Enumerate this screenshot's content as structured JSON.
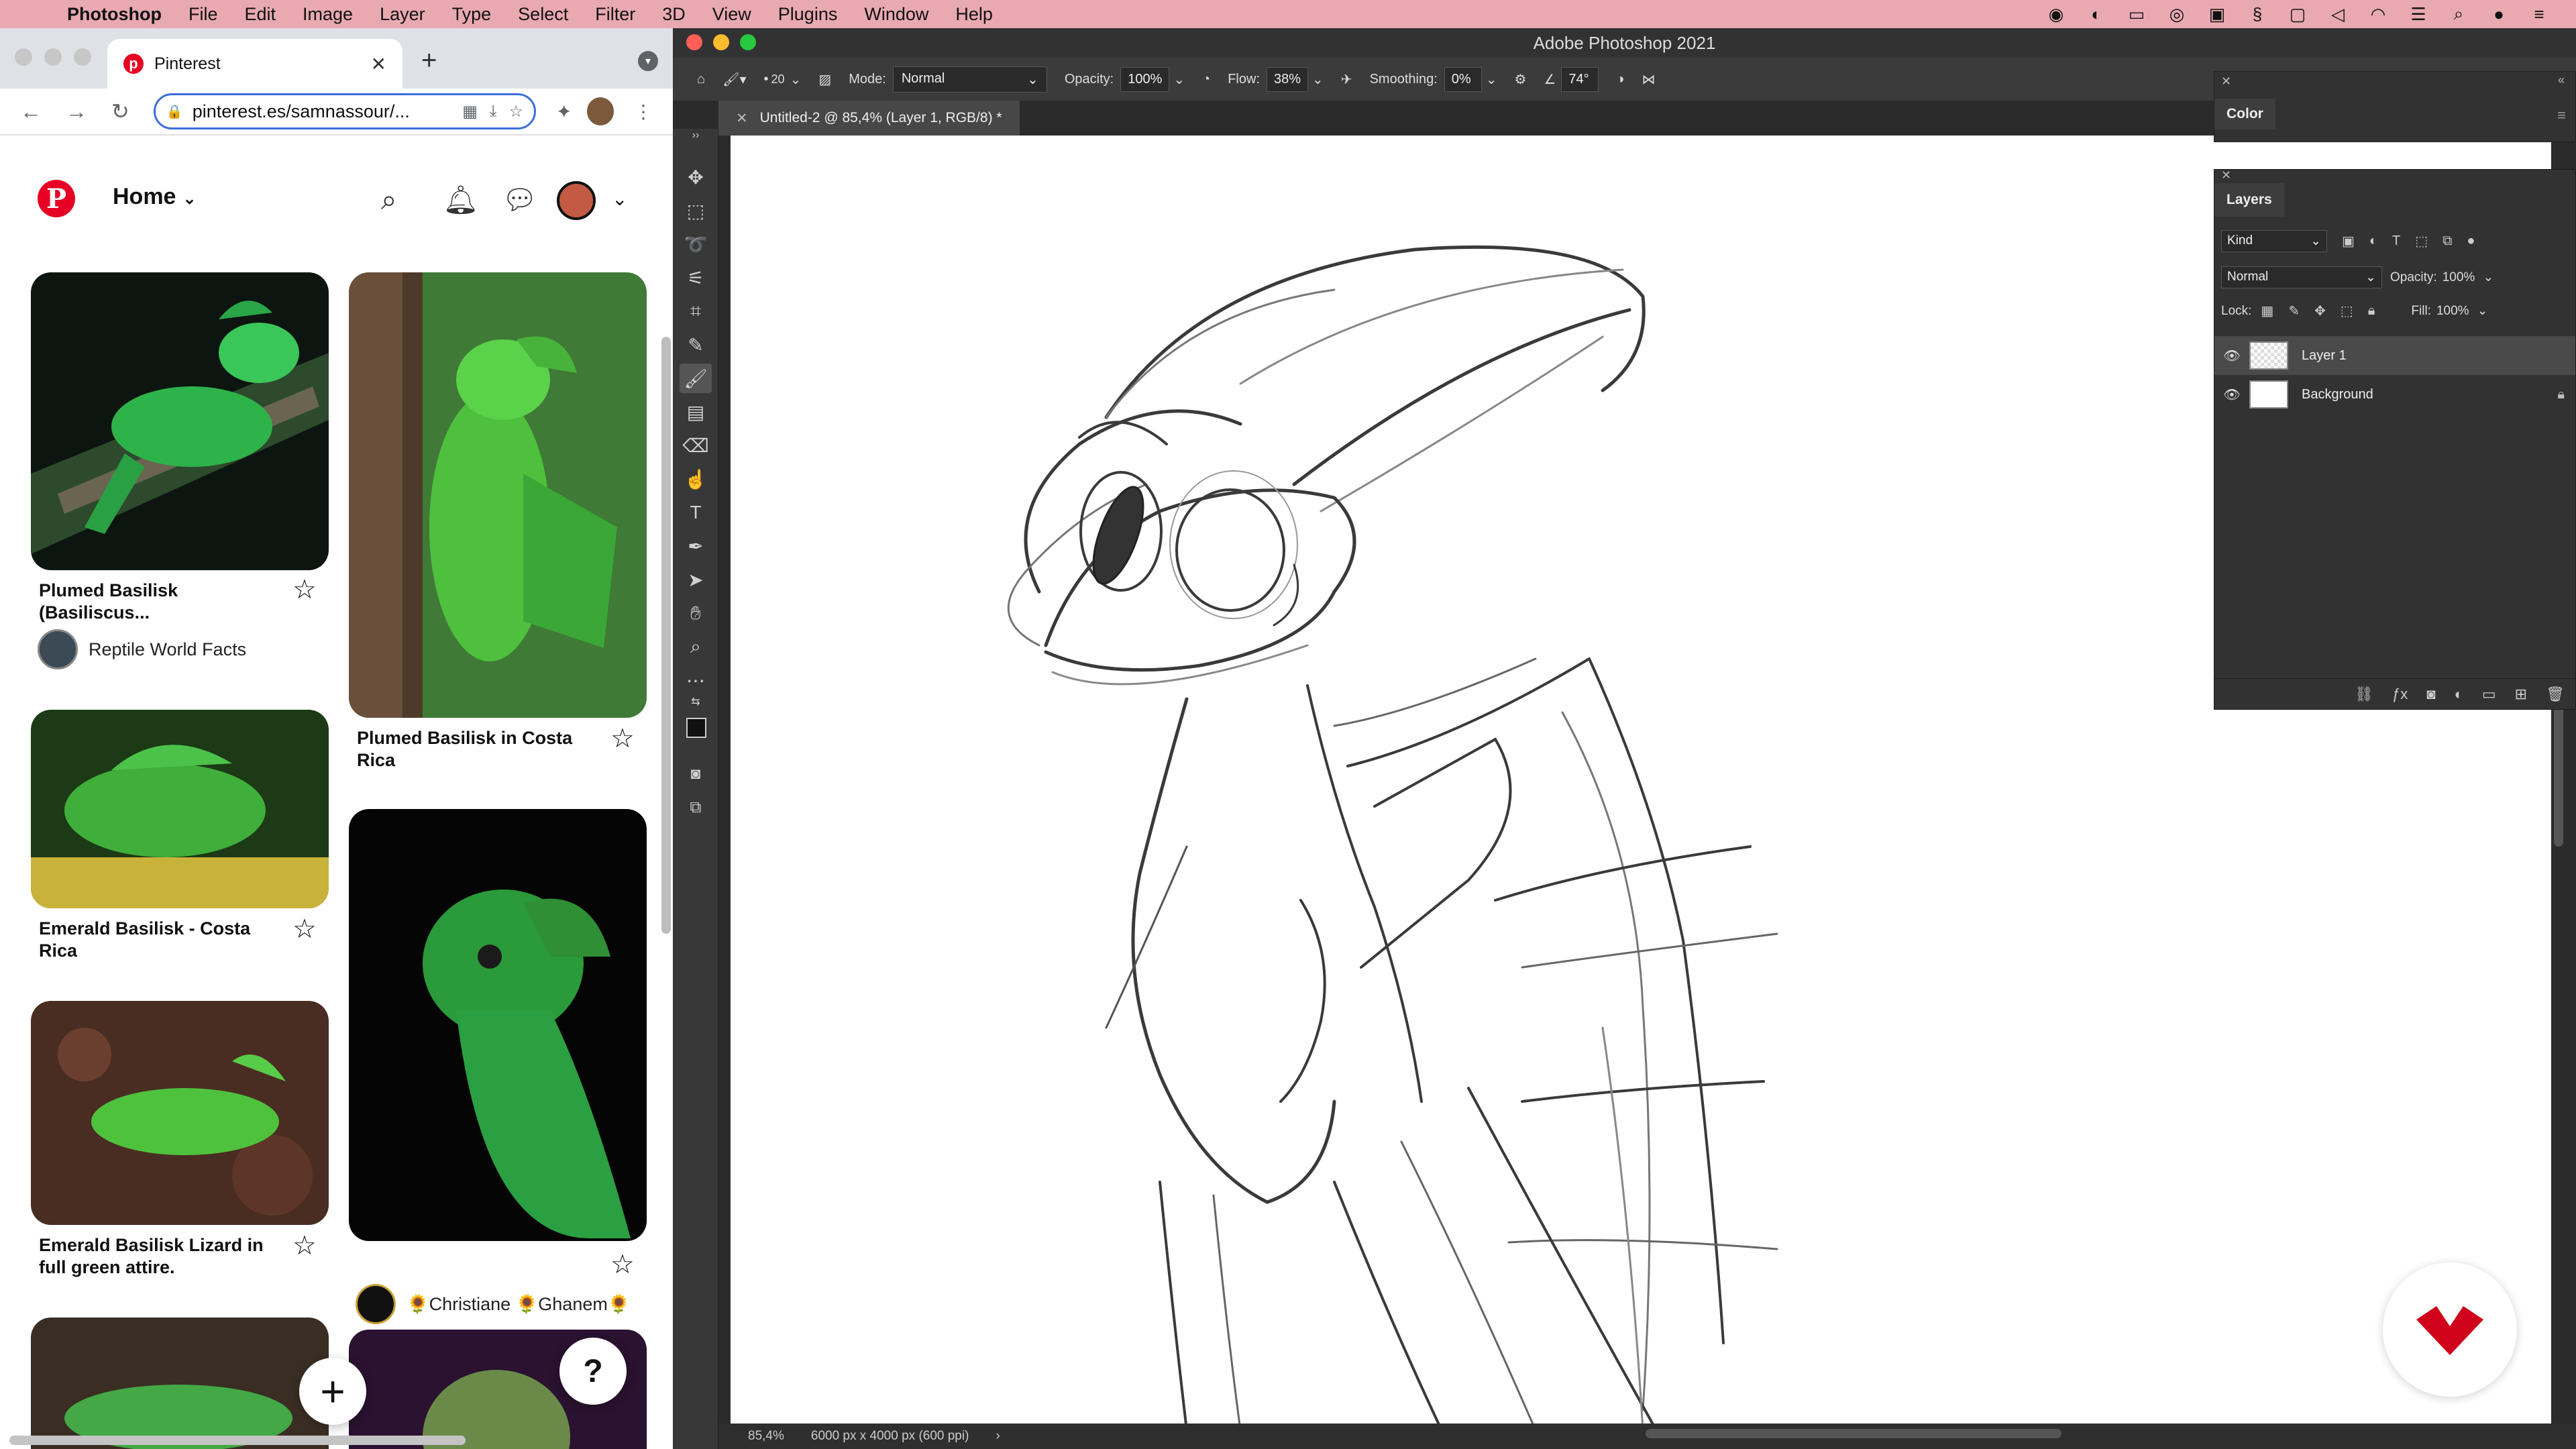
{
  "menubar": {
    "app": "Photoshop",
    "items": [
      "File",
      "Edit",
      "Image",
      "Layer",
      "Type",
      "Select",
      "Filter",
      "3D",
      "View",
      "Plugins",
      "Window",
      "Help"
    ],
    "status_icons": [
      "creative-cloud-icon",
      "disk-icon",
      "display-icon",
      "circle-icon",
      "mail-icon",
      "s-icon",
      "screen-icon",
      "volume-icon",
      "wifi-icon",
      "control-icon",
      "search-icon",
      "user-icon",
      "control-center-icon"
    ]
  },
  "chrome": {
    "tab_title": "Pinterest",
    "url": "pinterest.es/samnassour/..."
  },
  "pinterest": {
    "home_label": "Home",
    "pins": [
      {
        "title_line1": "Plumed Basilisk",
        "title_line2": "(Basiliscus...",
        "source": "Reptile World Facts"
      },
      {
        "title_line1": "Plumed Basilisk in Costa",
        "title_line2": "Rica"
      },
      {
        "title_line1": "Emerald Basilisk - Costa",
        "title_line2": "Rica"
      },
      {
        "title_line1": "Emerald Basilisk Lizard in",
        "title_line2": "full green attire."
      },
      {
        "source": "🌻Christiane 🌻Ghanem🌻"
      }
    ],
    "help_label": "?",
    "plus_label": "+"
  },
  "photoshop": {
    "title": "Adobe Photoshop 2021",
    "options": {
      "brush_size": "20",
      "mode_label": "Mode:",
      "mode_value": "Normal",
      "opacity_label": "Opacity:",
      "opacity_value": "100%",
      "flow_label": "Flow:",
      "flow_value": "38%",
      "smoothing_label": "Smoothing:",
      "smoothing_value": "0%",
      "angle_value": "74°"
    },
    "doc_tab": "Untitled-2 @ 85,4% (Layer 1, RGB/8) *",
    "status": {
      "zoom": "85,4%",
      "dimensions": "6000 px x 4000 px (600 ppi)",
      "arrow": "›"
    },
    "color_panel": {
      "title": "Color"
    },
    "layers_panel": {
      "title": "Layers",
      "filter": "Kind",
      "blend_mode": "Normal",
      "opacity_label": "Opacity:",
      "opacity_value": "100%",
      "lock_label": "Lock:",
      "fill_label": "Fill:",
      "fill_value": "100%",
      "layers": [
        {
          "name": "Layer 1",
          "selected": true
        },
        {
          "name": "Background",
          "locked": true
        }
      ]
    }
  }
}
